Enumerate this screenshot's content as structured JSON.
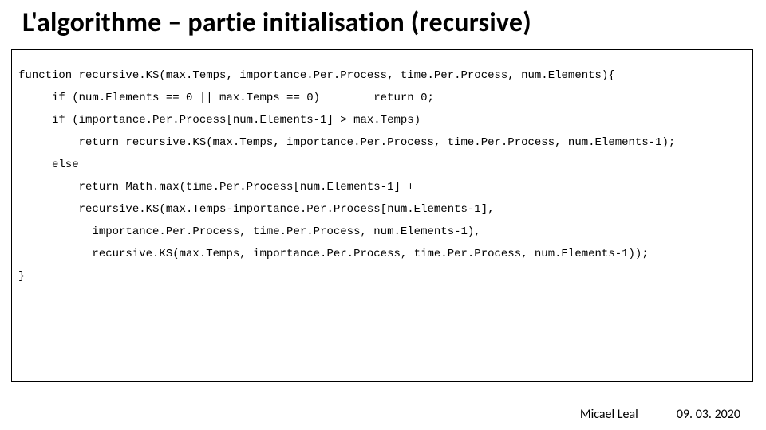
{
  "slide": {
    "title": "L'algorithme – partie initialisation (recursive)"
  },
  "code": {
    "line1": "function recursive.KS(max.Temps, importance.Per.Process, time.Per.Process, num.Elements){",
    "line2": "     if (num.Elements == 0 || max.Temps == 0)        return 0;",
    "line3": "     if (importance.Per.Process[num.Elements-1] > max.Temps)",
    "line4": "         return recursive.KS(max.Temps, importance.Per.Process, time.Per.Process, num.Elements-1);",
    "line5": "     else",
    "line6": "         return Math.max(time.Per.Process[num.Elements-1] +",
    "line7": "         recursive.KS(max.Temps-importance.Per.Process[num.Elements-1],",
    "line8": "           importance.Per.Process, time.Per.Process, num.Elements-1),",
    "line9": "           recursive.KS(max.Temps, importance.Per.Process, time.Per.Process, num.Elements-1));",
    "line10": "}"
  },
  "footer": {
    "author": "Micael Leal",
    "date": "09. 03. 2020"
  }
}
